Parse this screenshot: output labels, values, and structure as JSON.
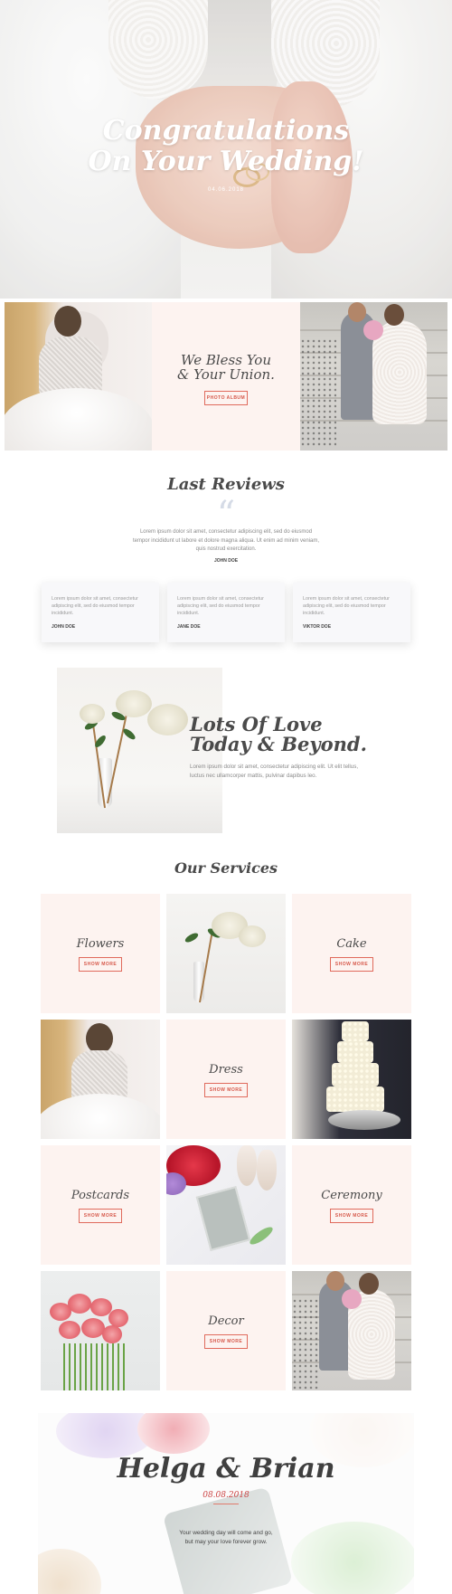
{
  "hero": {
    "title_line1": "Congratulations",
    "title_line2": "On Your Wedding!",
    "date": "04.06.2018"
  },
  "bless": {
    "title_line1": "We Bless You",
    "title_line2": "& Your Union.",
    "button": "PHOTO ALBUM"
  },
  "reviews": {
    "title": "Last Reviews",
    "quote_mark": "“",
    "main": {
      "text": "Lorem ipsum dolor sit amet, consectetur adipiscing elit, sed do eiusmod tempor incididunt ut labore et dolore magna aliqua. Ut enim ad minim veniam, quis nostrud exercitation.",
      "author": "JOHN DOE"
    },
    "cards": [
      {
        "text": "Lorem ipsum dolor sit amet, consectetur adipiscing elit, sed do eiusmod tempor incididunt.",
        "author": "JOHN DOE"
      },
      {
        "text": "Lorem ipsum dolor sit amet, consectetur adipiscing elit, sed do eiusmod tempor incididunt.",
        "author": "JANE DOE"
      },
      {
        "text": "Lorem ipsum dolor sit amet, consectetur adipiscing elit, sed do eiusmod tempor incididunt.",
        "author": "VIKTOR DOE"
      }
    ]
  },
  "love": {
    "title_line1": "Lots Of Love",
    "title_line2": "Today & Beyond.",
    "text": "Lorem ipsum dolor sit amet, consectetur adipiscing elit. Ut elit tellus, luctus nec ullamcorper mattis, pulvinar dapibus leo."
  },
  "services": {
    "title": "Our Services",
    "button": "SHOW MORE",
    "items": [
      {
        "label": "Flowers"
      },
      {
        "label": "Cake"
      },
      {
        "label": "Dress"
      },
      {
        "label": "Postcards"
      },
      {
        "label": "Ceremony"
      },
      {
        "label": "Decor"
      }
    ]
  },
  "footer": {
    "names": "Helga & Brian",
    "date": "08.08.2018",
    "text_line1": "Your wedding day will come and go,",
    "text_line2": "but may your love forever grow."
  },
  "colors": {
    "accent": "#e06a5c",
    "pink_tile": "#fdf3f0",
    "review_card": "#f8f8fa"
  }
}
